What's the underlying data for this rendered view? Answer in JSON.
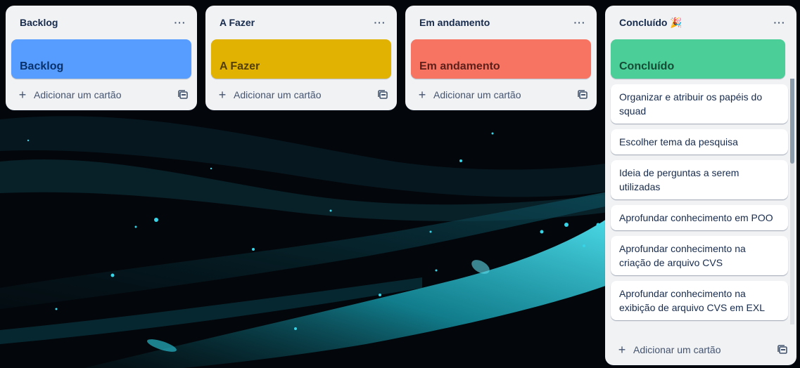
{
  "colors": {
    "list_background": "#f1f2f4",
    "backlog_cover": "#579dff",
    "afazer_cover": "#e2b203",
    "andamento_cover": "#f87462",
    "concluido_cover": "#4bce97"
  },
  "lists": [
    {
      "title": "Backlog",
      "cover_label": "Backlog",
      "menu_icon": "ellipsis-icon",
      "add_card_label": "Adicionar um cartão"
    },
    {
      "title": "A Fazer",
      "cover_label": "A Fazer",
      "menu_icon": "ellipsis-icon",
      "add_card_label": "Adicionar um cartão"
    },
    {
      "title": "Em andamento",
      "cover_label": "Em andamento",
      "menu_icon": "ellipsis-icon",
      "add_card_label": "Adicionar um cartão"
    },
    {
      "title": "Concluído",
      "title_emoji": "🎉",
      "cover_label": "Concluído",
      "menu_icon": "ellipsis-icon",
      "add_card_label": "Adicionar um cartão",
      "cards": [
        "Organizar e atribuir os papéis do squad",
        "Escolher tema da pesquisa",
        "Ideia de perguntas a serem utilizadas",
        "Aprofundar conhecimento em POO",
        "Aprofundar conhecimento na criação de arquivo CVS",
        "Aprofundar conhecimento na exibição de arquivo CVS em EXL"
      ]
    }
  ]
}
